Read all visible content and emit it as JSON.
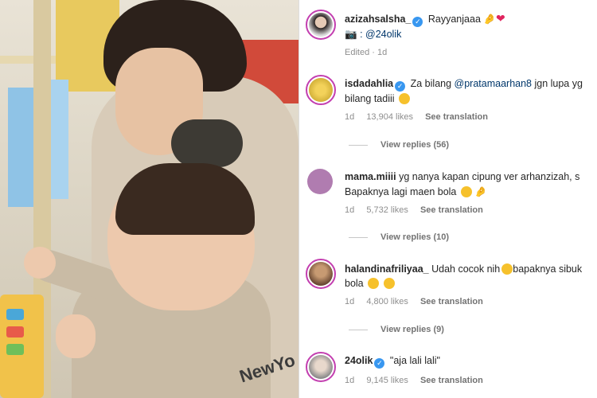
{
  "post": {
    "username": "azizahsalsha_",
    "caption": "Rayyanjaaa",
    "caption_emojis": [
      "pinched-fingers",
      "red-heart"
    ],
    "photo_credit": ": @24olik",
    "edited": "Edited · 1d"
  },
  "comments": [
    {
      "username": "isdadahlia",
      "verified": true,
      "text_before": "Za bilang ",
      "mention": "@pratamaarhan8",
      "text_after": " jgn lupa yg",
      "line2": "bilang tadiii",
      "age": "1d",
      "likes": "13,904 likes",
      "see_translation": "See translation",
      "view_replies": "View replies (56)"
    },
    {
      "username": "mama.miiii",
      "verified": false,
      "text": "yg nanya kapan cipung ver arhanzizah, s",
      "line2": "Bapaknya lagi maen bola",
      "age": "1d",
      "likes": "5,732 likes",
      "see_translation": "See translation",
      "view_replies": "View replies (10)"
    },
    {
      "username": "halandinafriliyaa_",
      "verified": false,
      "text": "Udah cocok nih",
      "text2": "bapaknya sibuk",
      "line2": "bola",
      "age": "1d",
      "likes": "4,800 likes",
      "see_translation": "See translation",
      "view_replies": "View replies (9)"
    },
    {
      "username": "24olik",
      "verified": true,
      "text": "\"aja lali lali\"",
      "age": "1d",
      "likes": "9,145 likes",
      "see_translation": "See translation"
    }
  ],
  "photo": {
    "shirt_print": "NewYo"
  },
  "colors": {
    "story_ring": "#c33fb0",
    "verified": "#3897f0",
    "mention": "#00376b",
    "meta": "#8e8e8e"
  }
}
